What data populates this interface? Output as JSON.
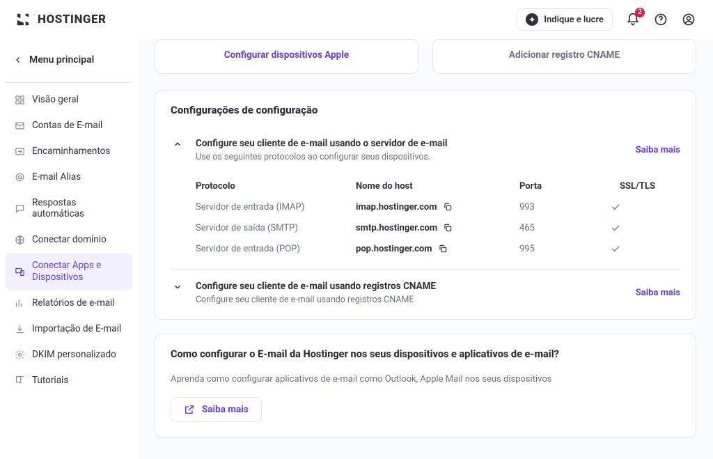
{
  "header": {
    "brand": "HOSTINGER",
    "refer_label": "Indique e lucre",
    "notif_count": "2"
  },
  "sidebar": {
    "back_label": "Menu principal",
    "items": [
      {
        "label": "Visão geral"
      },
      {
        "label": "Contas de E-mail"
      },
      {
        "label": "Encaminhamentos"
      },
      {
        "label": "E-mail Alias"
      },
      {
        "label": "Respostas automáticas"
      },
      {
        "label": "Conectar domínio"
      },
      {
        "label": "Conectar Apps e Dispositivos"
      },
      {
        "label": "Relatórios de e-mail"
      },
      {
        "label": "Importação de E-mail"
      },
      {
        "label": "DKIM personalizado"
      },
      {
        "label": "Tutoriais"
      }
    ]
  },
  "top": {
    "apple": "Configurar dispositivos Apple",
    "cname": "Adicionar registro CNAME"
  },
  "config": {
    "title": "Configurações de configuração",
    "sec1_title": "Configure seu cliente de e-mail usando o servidor de e-mail",
    "sec1_sub": "Use os seguintes protocolos ao configurar seus dispositivos.",
    "learn": "Saiba mais",
    "headers": {
      "proto": "Protocolo",
      "host": "Nome do host",
      "port": "Porta",
      "ssl": "SSL/TLS"
    },
    "rows": [
      {
        "proto": "Servidor de entrada (IMAP)",
        "host": "imap.hostinger.com",
        "port": "993"
      },
      {
        "proto": "Servidor de saída (SMTP)",
        "host": "smtp.hostinger.com",
        "port": "465"
      },
      {
        "proto": "Servidor de entrada (POP)",
        "host": "pop.hostinger.com",
        "port": "995"
      }
    ],
    "sec2_title": "Configure seu cliente de e-mail usando registros CNAME",
    "sec2_sub": "Configure seu cliente de e-mail usando registros CNAME"
  },
  "help": {
    "title": "Como configurar o E-mail da Hostinger nos seus dispositivos e aplicativos de e-mail?",
    "sub": "Aprenda como configurar aplicativos de e-mail como Outlook, Apple Mail nos seus dispositivos",
    "btn": "Saiba mais"
  }
}
